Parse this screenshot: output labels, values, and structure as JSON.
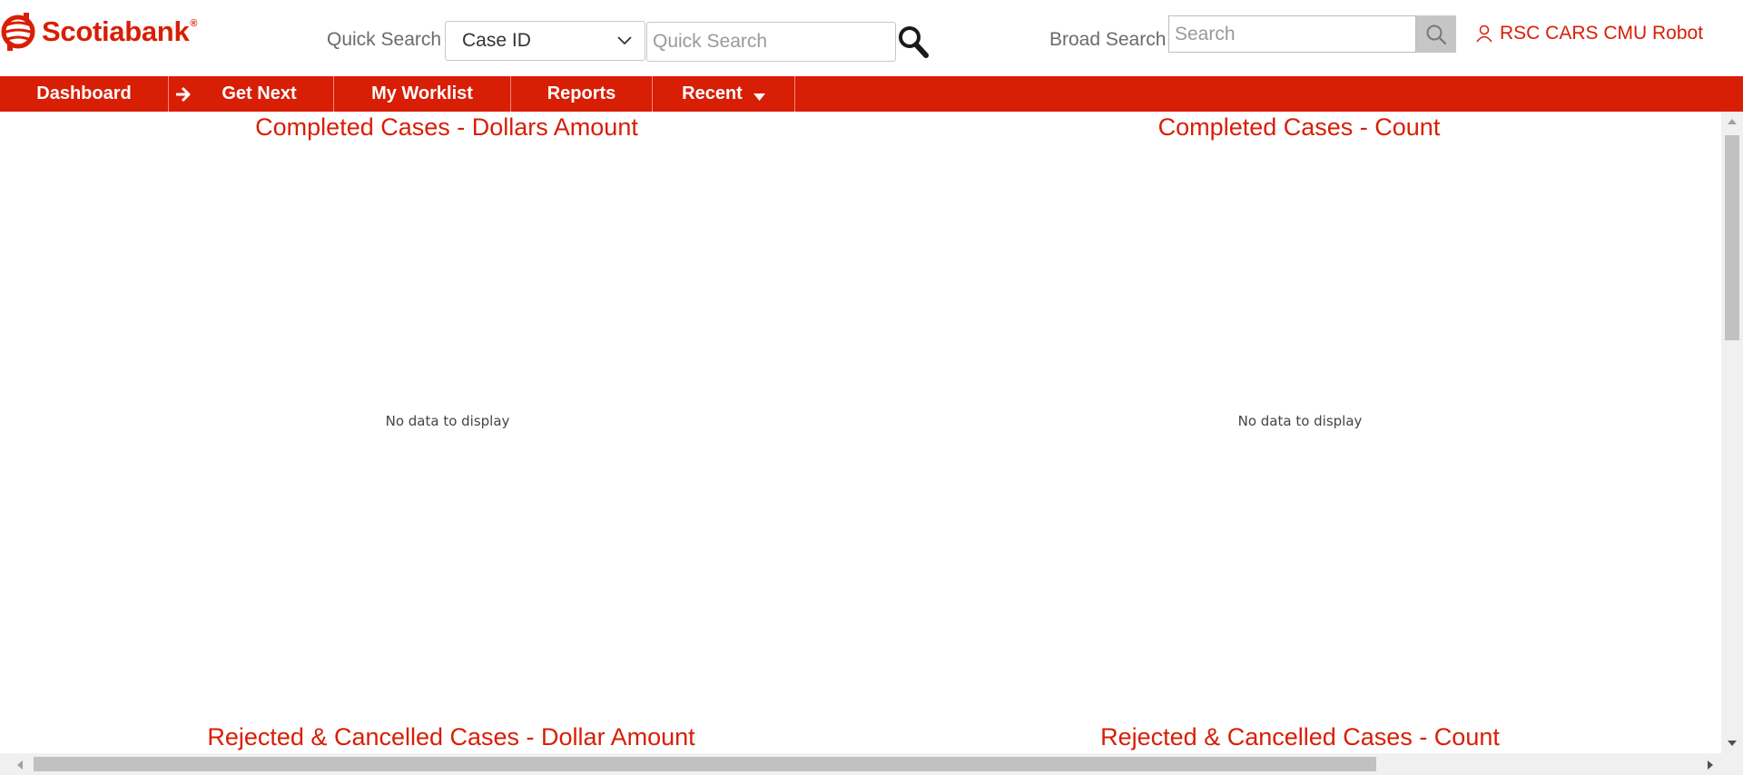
{
  "brand": {
    "name": "Scotiabank",
    "reg_mark": "®",
    "icon": "scotiabank-logo-icon",
    "color": "#d81e05"
  },
  "header": {
    "quick_search": {
      "label": "Quick Search",
      "select_value": "Case ID",
      "placeholder": "Quick Search",
      "icon": "search-icon"
    },
    "broad_search": {
      "label": "Broad Search",
      "placeholder": "Search",
      "icon": "search-icon"
    },
    "user": {
      "name": "RSC CARS CMU Robot",
      "icon": "user-icon"
    }
  },
  "nav": {
    "background": "#d81e05",
    "items": [
      {
        "label": "Dashboard"
      },
      {
        "label": "Get Next",
        "icon": "arrow-right-icon"
      },
      {
        "label": "My Worklist"
      },
      {
        "label": "Reports"
      },
      {
        "label": "Recent",
        "icon": "caret-down-icon"
      }
    ]
  },
  "charts": [
    {
      "title": "Completed Cases - Dollars Amount",
      "empty_text": "No data to display"
    },
    {
      "title": "Completed Cases - Count",
      "empty_text": "No data to display"
    },
    {
      "title": "Rejected & Cancelled Cases - Dollar Amount"
    },
    {
      "title": "Rejected & Cancelled Cases - Count"
    }
  ]
}
